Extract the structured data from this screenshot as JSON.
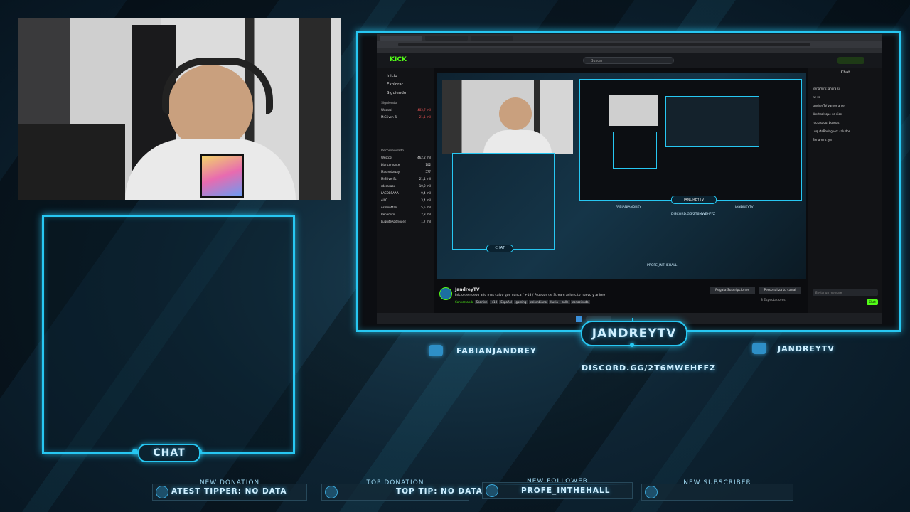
{
  "chat_label": "CHAT",
  "streamer_name": "JANDREYTV",
  "socials": {
    "instagram": "FABIANJANDREY",
    "youtube": "JANDREYTV",
    "discord": "DISCORD.GG/2T6MWEHFFZ"
  },
  "bottom_bar": {
    "new_donation": {
      "title": "NEW DONATION",
      "value": "ATEST TIPPER: NO DATA"
    },
    "top_donation": {
      "title": "TOP DONATION",
      "value": "TOP TIP: NO DATA"
    },
    "new_follower": {
      "title": "NEW FOLLOWER",
      "value": "PROFE_INTHEHALL"
    },
    "new_subscriber": {
      "title": "NEW SUBSCRIBER",
      "value": ""
    }
  },
  "screen": {
    "site_logo": "KICK",
    "nav": [
      "Inicio",
      "Explorar",
      "Siguiendo"
    ],
    "following_header": "Siguiendo",
    "following": [
      {
        "name": "Westcol",
        "count": "483,7 mil"
      },
      {
        "name": "MrStiven Tc",
        "count": "21,1 mil"
      }
    ],
    "recommended_header": "Recomendado",
    "recommended": [
      {
        "name": "Westcol",
        "count": "462,2 mil"
      },
      {
        "name": "blancomonte",
        "count": "102"
      },
      {
        "name": "Mashedoway",
        "count": "577"
      },
      {
        "name": "MrStivenTc",
        "count": "21,1 mil"
      },
      {
        "name": "rdcsasaoo",
        "count": "10,2 mil"
      },
      {
        "name": "LACOBRAAA",
        "count": "9,4 mil"
      },
      {
        "name": "elXO",
        "count": "3,4 mil"
      },
      {
        "name": "AsTconMan",
        "count": "5,5 mil"
      },
      {
        "name": "Benamiro",
        "count": "2,8 mil"
      },
      {
        "name": "LuquiteRodriguez",
        "count": "1,7 mil"
      }
    ],
    "search_placeholder": "Buscar",
    "chat_header": "Chat",
    "stream_title": "JandreyTV",
    "stream_desc": "Inicio de nuevo año mas calvo que nunca / +18 / Pruebas de Stream avioncito nuevo y anime",
    "tags": [
      "Conversando",
      "Spanish",
      "+18",
      "Español",
      "gaming",
      "colombiano",
      "lluvia",
      "calle",
      "conociendo"
    ],
    "gift_sub_button": "Regala Suscripciones",
    "customize_button": "Personaliza tu canal",
    "viewers": "8 Espectadores",
    "chat_input_placeholder": "Enviar un mensaje",
    "chat_button": "Chat",
    "mini_overlay_chat": "CHAT",
    "mini_name": "JANDREYTV",
    "mini_discord": "DISCORD.GG/2T6MWEHFFZ",
    "mini_insta": "FABIANJANDREY",
    "mini_yt": "JANDREYTV",
    "mini_follower": "PROFE_INTHEHALL",
    "chat_messages": [
      "Benamiro: ahora si",
      "tv: xd",
      "JandreyTV vamos a ver",
      "Westcol: que se dice",
      "rdcsasaoo: buenas",
      "LuquiteRodriguez: saludos",
      "Benamiro: ya"
    ]
  }
}
